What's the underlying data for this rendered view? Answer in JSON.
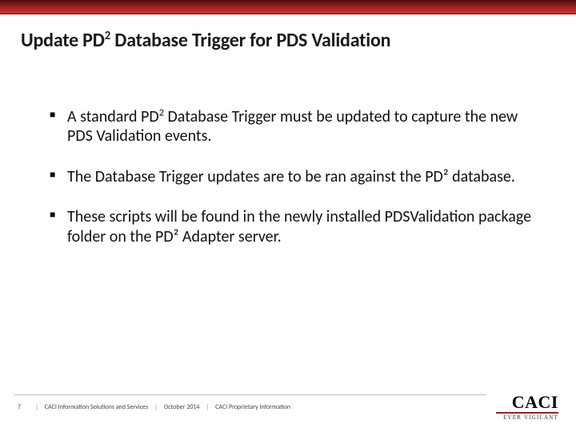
{
  "title_html": "Update PD<sup>2</sup> Database Trigger for PDS Validation",
  "bullets": [
    "A standard PD<sup>2</sup> Database Trigger must be updated to capture the new PDS Validation events.",
    "The Database Trigger updates are to be ran against the PD² database.",
    "These scripts will be found in the newly installed PDSValidation package folder on the PD² Adapter server."
  ],
  "footer": {
    "page": "7",
    "org": "CACI Information Solutions and Services",
    "date": "October 2014",
    "notice": "CACI Proprietary Information"
  },
  "logo": {
    "name": "CACI",
    "tagline": "EVER VIGILANT"
  }
}
